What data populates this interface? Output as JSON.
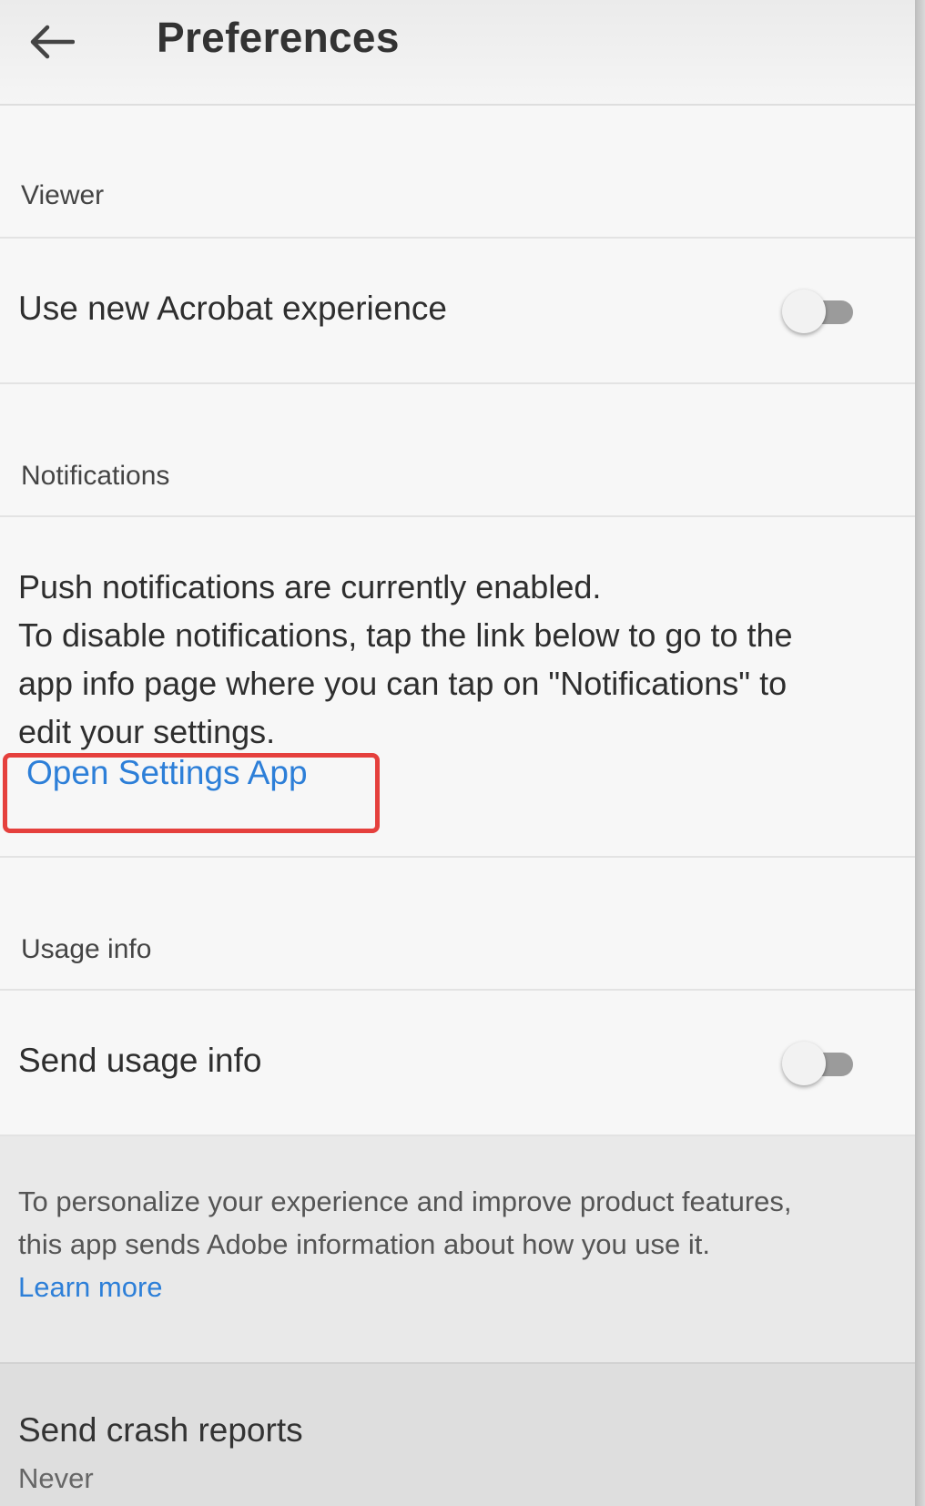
{
  "header": {
    "back_icon": "arrow-left-icon",
    "title": "Preferences"
  },
  "sections": {
    "viewer": {
      "header": "Viewer",
      "new_acrobat": {
        "label": "Use new Acrobat experience",
        "toggle_on": false
      }
    },
    "notifications": {
      "header": "Notifications",
      "line1": "Push notifications are currently enabled.",
      "line2": "To disable notifications, tap the link below to go to the",
      "line3": "app info page where you can tap on \"Notifications\" to",
      "line4": "edit your settings.",
      "link": "Open Settings App"
    },
    "usage": {
      "header": "Usage info",
      "send_usage": {
        "label": "Send usage info",
        "toggle_on": false
      },
      "desc_line1": "To personalize your experience and improve product features,",
      "desc_line2": "this app sends Adobe information about how you use it.",
      "learn_more": "Learn more"
    },
    "crash": {
      "label": "Send crash reports",
      "value": "Never"
    }
  },
  "colors": {
    "link": "#2d7fd8",
    "highlight": "#e5403d",
    "toggle_track": "#9b9b9b"
  }
}
